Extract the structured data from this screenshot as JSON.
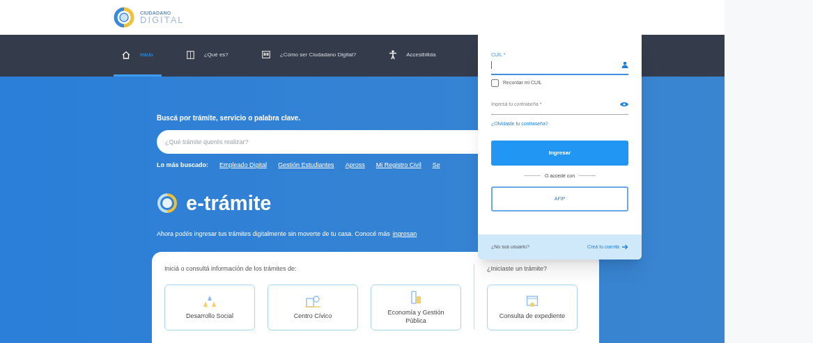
{
  "header": {
    "logo_top": "CIUDADANO",
    "logo_bottom": "DIGITAL"
  },
  "nav": [
    {
      "label": "Inicio",
      "selected": true
    },
    {
      "label": "¿Qué es?",
      "selected": false
    },
    {
      "label": "¿Cómo ser Ciudadano Digital?",
      "selected": false
    },
    {
      "label": "Accesibilida",
      "selected": false
    }
  ],
  "search": {
    "label": "Buscá por trámite, servicio o palabra clave.",
    "placeholder": "¿Qué trámite querés realizar?"
  },
  "popular": {
    "label": "Lo más buscado:",
    "links": [
      "Empleado Digital",
      "Gestión Estudiantes",
      "Apross",
      "Mi Registro Civil",
      "Se"
    ]
  },
  "brand": {
    "title": "e-trámite",
    "text": "Ahora podés ingresar tus trámites digitalmente sin moverte de tu casa. Conocé más",
    "link": "ingresan"
  },
  "panel": {
    "heading": "Iniciá o consultá información de los trámites de:",
    "tiles": [
      {
        "label": "Desarrollo Social"
      },
      {
        "label": "Centro Cívico"
      },
      {
        "label": "Economía y Gestión Pública"
      }
    ],
    "side_heading": "¿Iniciaste un trámite?",
    "side_tiles": [
      {
        "label": "Consulta de expediente"
      }
    ]
  },
  "login": {
    "cuil_label": "CUIL *",
    "remember": {
      "label": "Recordar mi CUIL",
      "checked": false
    },
    "password_placeholder": "Ingresá tu contraseña *",
    "forgot": "¿Olvidaste tu contraseña?",
    "submit": "Ingresar",
    "divider": "O accedé con",
    "alt_button": "AFIP",
    "footer_text": "¿No sos usuario?",
    "footer_link": "Creá tu cuenta"
  }
}
